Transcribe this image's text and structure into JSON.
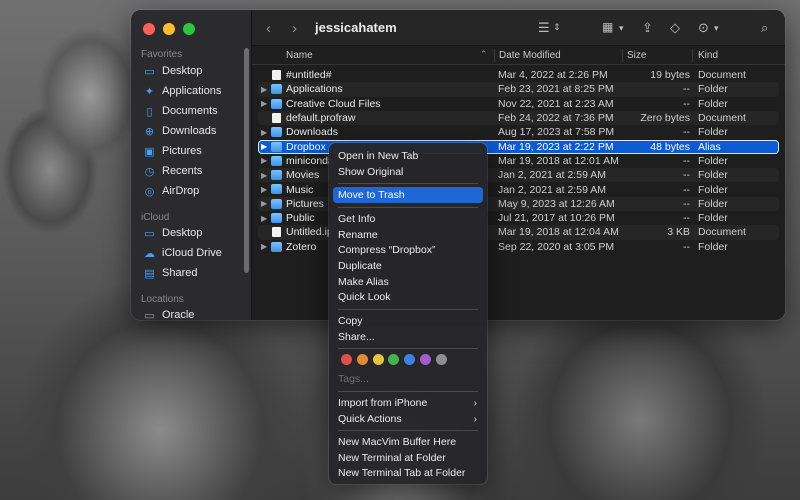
{
  "window": {
    "title": "jessicahatem"
  },
  "sidebar": {
    "sections": [
      {
        "label": "Favorites"
      },
      {
        "label": "iCloud"
      },
      {
        "label": "Locations"
      }
    ],
    "items": [
      {
        "label": "Desktop",
        "icon": "desktop-icon",
        "glyph": "▭"
      },
      {
        "label": "Applications",
        "icon": "applications-icon",
        "glyph": "✦"
      },
      {
        "label": "Documents",
        "icon": "document-icon",
        "glyph": "▯"
      },
      {
        "label": "Downloads",
        "icon": "downloads-icon",
        "glyph": "⊕"
      },
      {
        "label": "Pictures",
        "icon": "pictures-icon",
        "glyph": "▣"
      },
      {
        "label": "Recents",
        "icon": "clock-icon",
        "glyph": "◷"
      },
      {
        "label": "AirDrop",
        "icon": "airdrop-icon",
        "glyph": "◎"
      },
      {
        "label": "Desktop",
        "icon": "desktop-icon",
        "glyph": "▭"
      },
      {
        "label": "iCloud Drive",
        "icon": "cloud-icon",
        "glyph": "☁"
      },
      {
        "label": "Shared",
        "icon": "shared-folder-icon",
        "glyph": "▤"
      },
      {
        "label": "Oracle",
        "icon": "drive-icon",
        "glyph": "▭"
      }
    ]
  },
  "columns": {
    "name": "Name",
    "date": "Date Modified",
    "size": "Size",
    "kind": "Kind"
  },
  "files": [
    {
      "name": "#untitled#",
      "date": "Mar 4, 2022 at 2:26 PM",
      "size": "19 bytes",
      "kind": "Document",
      "type": "doc",
      "expandable": false
    },
    {
      "name": "Applications",
      "date": "Feb 23, 2021 at 8:25 PM",
      "size": "--",
      "kind": "Folder",
      "type": "folder",
      "expandable": true
    },
    {
      "name": "Creative Cloud Files",
      "date": "Nov 22, 2021 at 2:23 AM",
      "size": "--",
      "kind": "Folder",
      "type": "folder",
      "expandable": true
    },
    {
      "name": "default.profraw",
      "date": "Feb 24, 2022 at 7:36 PM",
      "size": "Zero bytes",
      "kind": "Document",
      "type": "doc",
      "expandable": false
    },
    {
      "name": "Downloads",
      "date": "Aug 17, 2023 at 7:58 PM",
      "size": "--",
      "kind": "Folder",
      "type": "folder",
      "expandable": true
    },
    {
      "name": "Dropbox",
      "date": "Mar 19, 2023 at 2:22 PM",
      "size": "48 bytes",
      "kind": "Alias",
      "type": "alias",
      "expandable": true,
      "selected": true
    },
    {
      "name": "miniconda",
      "date": "Mar 19, 2018 at 12:01 AM",
      "size": "--",
      "kind": "Folder",
      "type": "folder",
      "expandable": true
    },
    {
      "name": "Movies",
      "date": "Jan 2, 2021 at 2:59 AM",
      "size": "--",
      "kind": "Folder",
      "type": "folder",
      "expandable": true
    },
    {
      "name": "Music",
      "date": "Jan 2, 2021 at 2:59 AM",
      "size": "--",
      "kind": "Folder",
      "type": "folder",
      "expandable": true
    },
    {
      "name": "Pictures",
      "date": "May 9, 2023 at 12:26 AM",
      "size": "--",
      "kind": "Folder",
      "type": "folder",
      "expandable": true
    },
    {
      "name": "Public",
      "date": "Jul 21, 2017 at 10:26 PM",
      "size": "--",
      "kind": "Folder",
      "type": "folder",
      "expandable": true
    },
    {
      "name": "Untitled.ip",
      "date": "Mar 19, 2018 at 12:04 AM",
      "size": "3 KB",
      "kind": "Document",
      "type": "doc",
      "expandable": false
    },
    {
      "name": "Zotero",
      "date": "Sep 22, 2020 at 3:05 PM",
      "size": "--",
      "kind": "Folder",
      "type": "folder",
      "expandable": true
    }
  ],
  "context_menu": {
    "items": [
      {
        "label": "Open in New Tab",
        "name": "menu-open-new-tab"
      },
      {
        "label": "Show Original",
        "name": "menu-show-original"
      },
      {
        "label": "Move to Trash",
        "name": "menu-move-to-trash",
        "highlight": true
      },
      {
        "label": "Get Info",
        "name": "menu-get-info"
      },
      {
        "label": "Rename",
        "name": "menu-rename"
      },
      {
        "label": "Compress “Dropbox”",
        "name": "menu-compress"
      },
      {
        "label": "Duplicate",
        "name": "menu-duplicate"
      },
      {
        "label": "Make Alias",
        "name": "menu-make-alias"
      },
      {
        "label": "Quick Look",
        "name": "menu-quick-look"
      },
      {
        "label": "Copy",
        "name": "menu-copy"
      },
      {
        "label": "Share...",
        "name": "menu-share"
      },
      {
        "label": "Tags...",
        "name": "menu-tags",
        "disabled": true
      },
      {
        "label": "Import from iPhone",
        "name": "menu-import-iphone",
        "submenu": true
      },
      {
        "label": "Quick Actions",
        "name": "menu-quick-actions",
        "submenu": true
      },
      {
        "label": "New MacVim Buffer Here",
        "name": "menu-macvim-buffer"
      },
      {
        "label": "New Terminal at Folder",
        "name": "menu-new-terminal"
      },
      {
        "label": "New Terminal Tab at Folder",
        "name": "menu-new-terminal-tab"
      }
    ],
    "tag_colors": [
      "#e0504b",
      "#e58b2f",
      "#e3c43c",
      "#41b34d",
      "#3d82e0",
      "#a35bd0",
      "#8e8e8e"
    ],
    "tag_names": [
      "red",
      "orange",
      "yellow",
      "green",
      "blue",
      "purple",
      "gray"
    ]
  },
  "accent": "#0b5bd3"
}
